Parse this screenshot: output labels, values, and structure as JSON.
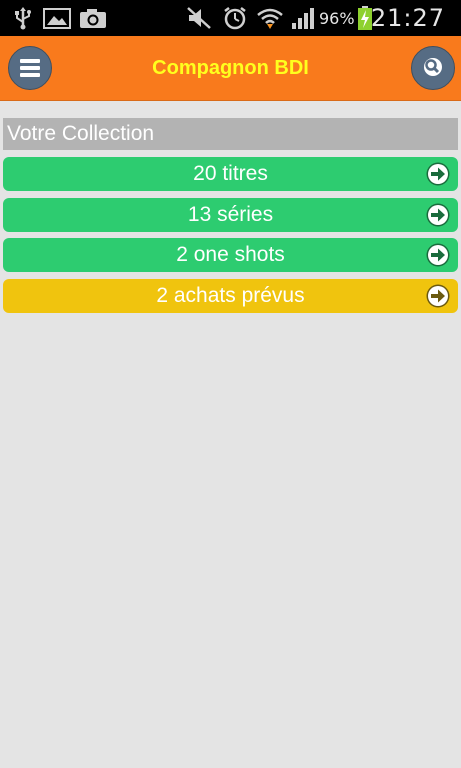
{
  "status_bar": {
    "battery_percent": "96%",
    "time": "21:27",
    "icons": [
      "usb-icon",
      "image-icon",
      "camera-icon",
      "mute-icon",
      "alarm-icon",
      "wifi-icon",
      "signal-icon",
      "battery-charging-icon"
    ]
  },
  "app_bar": {
    "title": "Compagnon BDI",
    "menu_icon": "hamburger-menu-icon",
    "search_icon": "search-icon"
  },
  "collection": {
    "header": "Votre Collection",
    "items": [
      {
        "label": "20 titres",
        "color": "#2dcc70"
      },
      {
        "label": "13 séries",
        "color": "#2dcc70"
      },
      {
        "label": "2 one shots",
        "color": "#2dcc70"
      },
      {
        "label": "2 achats prévus",
        "color": "#f0c40e"
      }
    ]
  },
  "colors": {
    "app_bar": "#f97a1c",
    "title_text": "#ffff1e",
    "round_button": "#566c84",
    "section_header": "#b3b3b3",
    "background": "#e4e4e4"
  }
}
